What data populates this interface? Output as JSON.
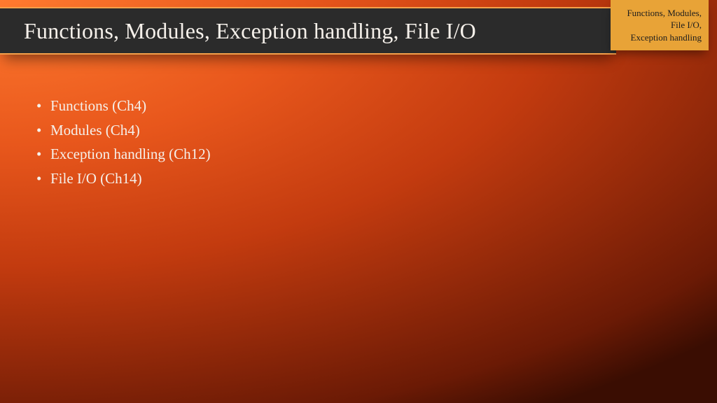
{
  "title": "Functions, Modules, Exception handling, File I/O",
  "tag": {
    "line1": "Functions, Modules,",
    "line2": "File I/O,",
    "line3": "Exception handling"
  },
  "bullets": [
    "Functions (Ch4)",
    "Modules (Ch4)",
    "Exception handling (Ch12)",
    "File I/O (Ch14)"
  ]
}
